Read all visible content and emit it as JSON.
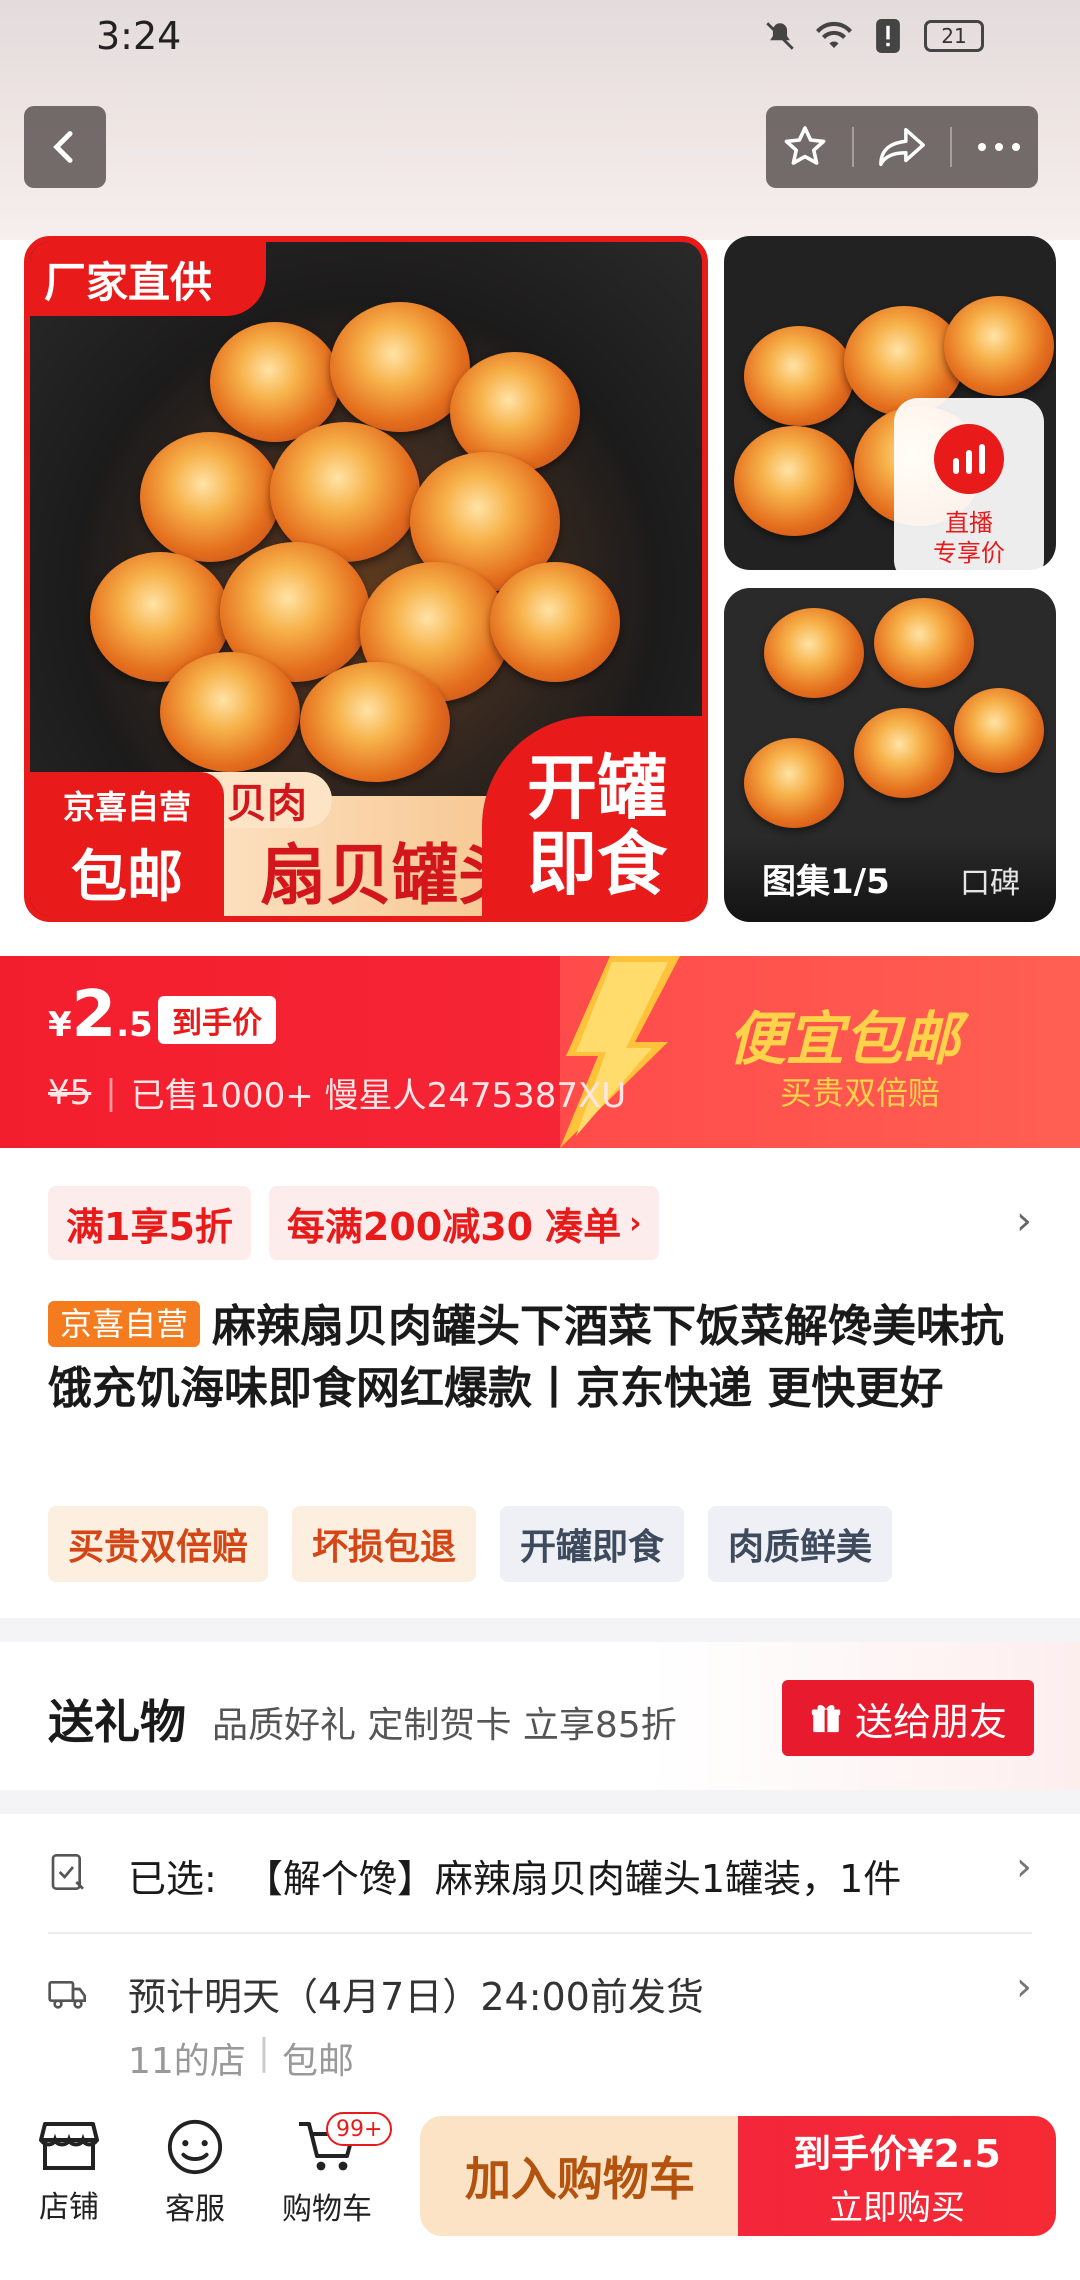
{
  "status_bar": {
    "time": "3:24",
    "battery": "21"
  },
  "gallery": {
    "badge_factory": "厂家直供",
    "banner_tag": "扇贝肉",
    "banner_text": "扇贝罐头",
    "badge_jx_top": "京喜自营",
    "badge_jx_bottom": "包邮",
    "badge_open_1": "开罐",
    "badge_open_2": "即食",
    "live_line1": "直播",
    "live_line2": "专享价",
    "counter": "图集1/5",
    "review": "口碑"
  },
  "price": {
    "yen": "¥",
    "int": "2",
    "dec": ".5",
    "tag": "到手价",
    "original": "¥5",
    "sold": "已售1000+ 慢星人2475387XU",
    "promo_big": "便宜包邮",
    "promo_small": "买贵双倍赔"
  },
  "coupons": {
    "c1": "满1享5折",
    "c2": "每满200减30",
    "c2_link": "凑单"
  },
  "title": {
    "tag": "京喜自营",
    "text": "麻辣扇贝肉罐头下酒菜下饭菜解馋美味抗饿充饥海味即食网红爆款丨京东快递 更快更好"
  },
  "feature_tags": [
    "买贵双倍赔",
    "坏损包退",
    "开罐即食",
    "肉质鲜美"
  ],
  "gift": {
    "title": "送礼物",
    "subtitle": "品质好礼 定制贺卡 立享85折",
    "button": "送给朋友"
  },
  "selection": {
    "label": "已选:",
    "value": "【解个馋】麻辣扇贝肉罐头1罐装，1件"
  },
  "shipping": {
    "line1": "预计明天（4月7日）24:00前发货",
    "shop": "11的店",
    "free": "包邮"
  },
  "bottom_bar": {
    "store": "店铺",
    "service": "客服",
    "cart": "购物车",
    "cart_count": "99+",
    "add_cart": "加入购物车",
    "buy_line1": "到手价¥2.5",
    "buy_line2": "立即购买"
  },
  "colors": {
    "brand_red": "#e81a1a",
    "promo_gold": "#ffd24a",
    "self_tag_orange": "#f47c1e"
  }
}
